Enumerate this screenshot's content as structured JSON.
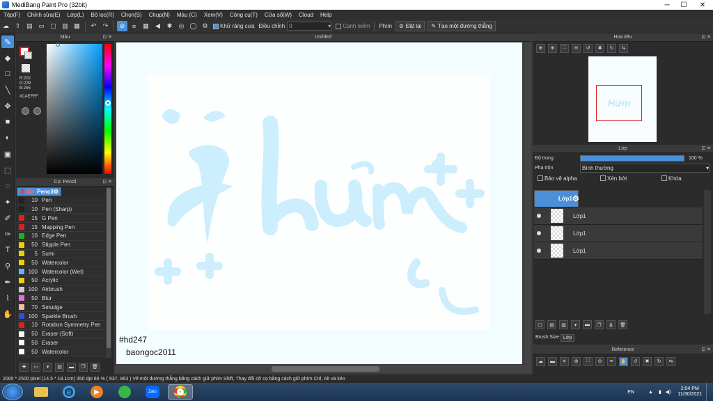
{
  "window": {
    "title": "MediBang Paint Pro (32bit)",
    "minimize": "─",
    "maximize": "☐",
    "close": "✕"
  },
  "menu": [
    "Tệp(F)",
    "Chỉnh sửa(E)",
    "Lớp(L)",
    "Bộ lọc(R)",
    "Chọn(S)",
    "Chụp(N)",
    "Màu (C)",
    "Xem(V)",
    "Công cụ(T)",
    "Cửa sổ(W)",
    "Cloud",
    "Help"
  ],
  "toolbar": {
    "antialias_label": "Khử răng cưa",
    "adjust_label": "Điều chỉnh",
    "adjust_value": "0",
    "edge_label": "Cạnh mềm",
    "key_label": "Phím",
    "reset_label": "Đặt lại",
    "straight_label": "Tạo một đường thẳng"
  },
  "color_panel": {
    "title": "Màu",
    "r": "R:202",
    "g": "G:239",
    "b": "B:255",
    "hex": "#CAEFFF",
    "fg_color": "#CAEFFF",
    "accent": "#4a90d9"
  },
  "brush_panel": {
    "title": "Cọ: Pencil",
    "items": [
      {
        "size": "40",
        "name": "Pencil",
        "color": "#ff3b3b",
        "selected": true
      },
      {
        "size": "10",
        "name": "Pen",
        "color": "#222222"
      },
      {
        "size": "10",
        "name": "Pen (Sharp)",
        "color": "#222222"
      },
      {
        "size": "15",
        "name": "G Pen",
        "color": "#e02020"
      },
      {
        "size": "15",
        "name": "Mapping Pen",
        "color": "#e02020"
      },
      {
        "size": "10",
        "name": "Edge Pen",
        "color": "#20b020"
      },
      {
        "size": "50",
        "name": "Stipple Pen",
        "color": "#f0d000"
      },
      {
        "size": "5",
        "name": "Sumi",
        "color": "#f0d000"
      },
      {
        "size": "50",
        "name": "Watercolor",
        "color": "#f0d000"
      },
      {
        "size": "100",
        "name": "Watercolor (Wet)",
        "color": "#6ab0ff"
      },
      {
        "size": "50",
        "name": "Acrylic",
        "color": "#f0d000"
      },
      {
        "size": "100",
        "name": "Airbrush",
        "color": "#cccccc"
      },
      {
        "size": "50",
        "name": "Blur",
        "color": "#e070e0"
      },
      {
        "size": "70",
        "name": "Smudge",
        "color": "#f0c0a0"
      },
      {
        "size": "100",
        "name": "Sparkle Brush",
        "color": "#3050e0"
      },
      {
        "size": "10",
        "name": "Rotation Symmetry Pen",
        "color": "#e02020"
      },
      {
        "size": "50",
        "name": "Eraser (Soft)",
        "color": "#ffffff"
      },
      {
        "size": "50",
        "name": "Eraser",
        "color": "#ffffff"
      },
      {
        "size": "50",
        "name": "Watercolor",
        "color": "#ffffff"
      }
    ]
  },
  "canvas": {
    "tab": "Untitled",
    "artwork_text": "Hửm",
    "caption1": "#hd247",
    "caption2": "baongoc2011",
    "paper": "#f3fcff",
    "ink": "#cdeefc"
  },
  "navigator": {
    "title": "Hoa tiêu"
  },
  "layer_panel": {
    "title": "Lớp",
    "opacity_label": "Độ trong",
    "opacity_value": "100 %",
    "opacity_fraction": 1,
    "blend_label": "Pha trộn",
    "blend_value": "Bình thường",
    "protect_alpha": "Bảo vệ alpha",
    "clipping": "Xén bớt",
    "lock": "Khóa",
    "layers": [
      {
        "name": "Lớp1",
        "selected": true
      },
      {
        "name": "Lớp1"
      },
      {
        "name": "Lớp1"
      },
      {
        "name": "Lớp1"
      }
    ],
    "tab_brush_size": "Brush Size",
    "tab_layer": "Lớp"
  },
  "reference_panel": {
    "title": "Reference"
  },
  "status": {
    "text": "2000 * 2500 pixel  (14.5 * 18.1cm)  350 dpi  66 %  ( 937, 863 )  Vẽ một đường thẳng bằng cách giữ phím Shift, Thay đổi cỡ cọ bằng cách giữ phím Ctrl, Alt và kéo"
  },
  "taskbar": {
    "lang": "EN",
    "time": "2:04 PM",
    "date": "11/30/2021"
  }
}
